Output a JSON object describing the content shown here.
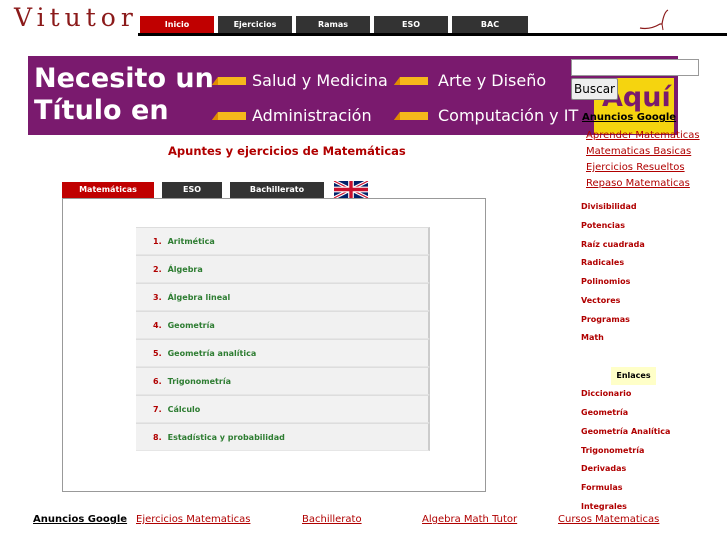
{
  "site": {
    "logo": "Vitutor"
  },
  "nav": [
    {
      "label": "Inicio"
    },
    {
      "label": "Ejercicios"
    },
    {
      "label": "Ramas"
    },
    {
      "label": "ESO"
    },
    {
      "label": "BAC"
    }
  ],
  "banner": {
    "line1": "Necesito un",
    "line2": "Título en",
    "items": [
      "Salud y Medicina",
      "Arte y Diseño",
      "Administración",
      "Computación y IT"
    ],
    "cta": "Aquí"
  },
  "search": {
    "value": "",
    "button_label": "Buscar"
  },
  "headline": "Apuntes y ejercicios de Matemáticas",
  "tabs": [
    {
      "label": "Matemáticas"
    },
    {
      "label": "ESO"
    },
    {
      "label": "Bachillerato"
    }
  ],
  "topics": [
    {
      "num": "1.",
      "label": "Aritmética"
    },
    {
      "num": "2.",
      "label": "Álgebra"
    },
    {
      "num": "3.",
      "label": "Álgebra lineal"
    },
    {
      "num": "4.",
      "label": "Geometría"
    },
    {
      "num": "5.",
      "label": "Geometría analítica"
    },
    {
      "num": "6.",
      "label": "Trigonometría"
    },
    {
      "num": "7.",
      "label": "Cálculo"
    },
    {
      "num": "8.",
      "label": "Estadística y probabilidad"
    }
  ],
  "google_ads": {
    "heading": "Anuncios Google",
    "links": [
      "Aprender Matematicas",
      "Matematicas Basicas",
      "Ejercicios Resueltos",
      "Repaso Matematicas"
    ]
  },
  "sidebar_links": [
    "Divisibilidad",
    "Potencias",
    "Raíz cuadrada",
    "Radicales",
    "Polinomios",
    "Vectores",
    "Programas",
    "Math"
  ],
  "enlaces": {
    "heading": "Enlaces",
    "links": [
      "Diccionario",
      "Geometría",
      "Geometría Analítica",
      "Trigonometría",
      "Derivadas",
      "Formulas",
      "Integrales"
    ]
  },
  "bottom_ads": {
    "heading": "Anuncios Google",
    "links": [
      "Ejercicios Matematicas",
      "Bachillerato",
      "Algebra Math Tutor",
      "Cursos Matematicas"
    ]
  }
}
